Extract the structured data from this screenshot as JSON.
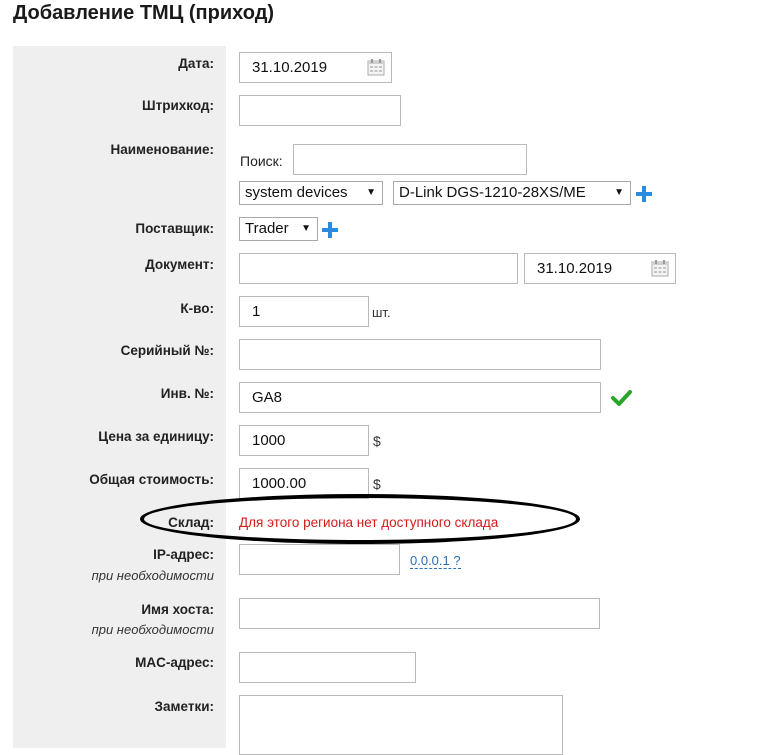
{
  "page": {
    "title": "Добавление ТМЦ (приход)"
  },
  "form": {
    "date": {
      "label": "Дата:",
      "value": "31.10.2019"
    },
    "barcode": {
      "label": "Штрихкод:",
      "value": ""
    },
    "name": {
      "label": "Наименование:",
      "search_label": "Поиск:",
      "search_value": "",
      "category": "system devices",
      "model": "D-Link DGS-1210-28XS/ME"
    },
    "supplier": {
      "label": "Поставщик:",
      "value": "Trader"
    },
    "document": {
      "label": "Документ:",
      "number": "",
      "date": "31.10.2019"
    },
    "quantity": {
      "label": "К-во:",
      "value": "1",
      "unit": "шт."
    },
    "serial": {
      "label": "Серийный №:",
      "value": ""
    },
    "inventory": {
      "label": "Инв. №:",
      "value": "GA8"
    },
    "unit_price": {
      "label": "Цена за единицу:",
      "value": "1000",
      "currency": "$"
    },
    "total": {
      "label": "Общая стоимость:",
      "value": "1000.00",
      "currency": "$"
    },
    "warehouse": {
      "label": "Склад:",
      "error": "Для этого региона нет доступного склада"
    },
    "ip": {
      "label": "IP-адрес:",
      "hint": "при необходимости",
      "value": "",
      "example": "0.0.0.1 ?"
    },
    "hostname": {
      "label": "Имя хоста:",
      "hint": "при необходимости",
      "value": ""
    },
    "mac": {
      "label": "MAC-адрес:",
      "value": ""
    },
    "notes": {
      "label": "Заметки:",
      "value": ""
    }
  },
  "colors": {
    "accent": "#2b8be0",
    "success": "#2aa52a",
    "error": "#d11a1a",
    "panel": "#efefef"
  }
}
